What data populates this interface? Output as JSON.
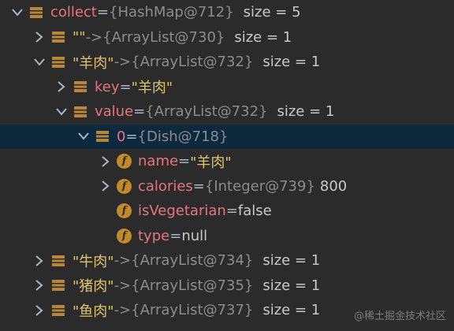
{
  "rows": [
    {
      "name": "collect",
      "op": " = ",
      "ref": "{HashMap@712}",
      "extra": "size = 5"
    },
    {
      "name": "\"\"",
      "op": " -> ",
      "ref": "{ArrayList@730}",
      "extra": "size = 1"
    },
    {
      "name": "\"羊肉\"",
      "op": " -> ",
      "ref": "{ArrayList@732}",
      "extra": "size = 1"
    },
    {
      "name": "key",
      "op": " = ",
      "val": "\"羊肉\""
    },
    {
      "name": "value",
      "op": " = ",
      "ref": "{ArrayList@732}",
      "extra": "size = 1"
    },
    {
      "name": "0",
      "op": " = ",
      "ref": "{Dish@718}"
    },
    {
      "name": "name",
      "op": " = ",
      "val": "\"羊肉\""
    },
    {
      "name": "calories",
      "op": " = ",
      "ref": "{Integer@739}",
      "val2": "800"
    },
    {
      "name": "isVegetarian",
      "op": " = ",
      "val2": "false"
    },
    {
      "name": "type",
      "op": " = ",
      "val2": "null"
    },
    {
      "name": "\"牛肉\"",
      "op": " -> ",
      "ref": "{ArrayList@734}",
      "extra": "size = 1"
    },
    {
      "name": "\"猪肉\"",
      "op": " -> ",
      "ref": "{ArrayList@735}",
      "extra": "size = 1"
    },
    {
      "name": "\"鱼肉\"",
      "op": " -> ",
      "ref": "{ArrayList@737}",
      "extra": "size = 1"
    }
  ],
  "watermark": "@稀土掘金技术社区",
  "colors": {
    "background": "#2b2b2b",
    "selected_row": "#0d293e",
    "variable_name": "#e4757f",
    "string_value": "#e0c46c",
    "field_icon": "#c18b2c"
  },
  "icons": [
    "chevron-right-icon",
    "chevron-down-icon",
    "list-icon",
    "field-icon"
  ]
}
